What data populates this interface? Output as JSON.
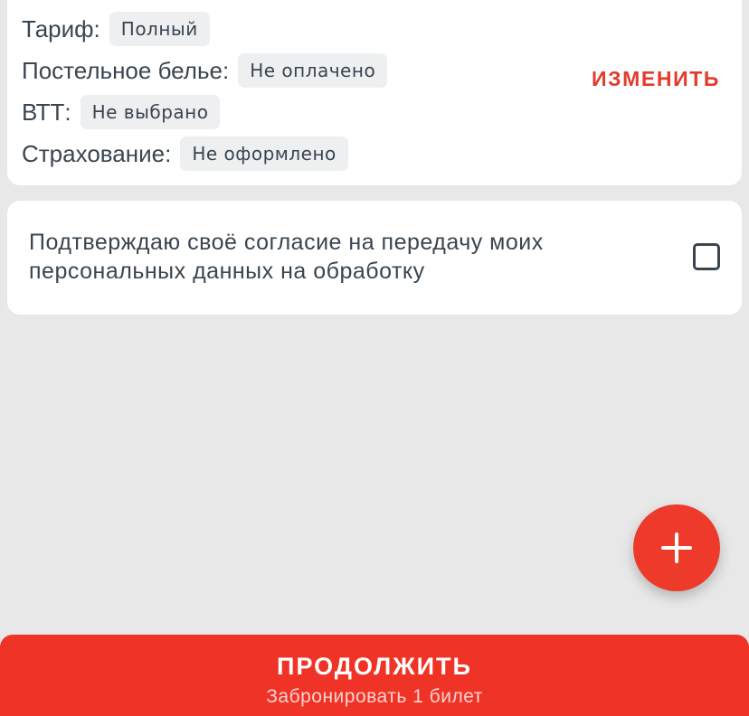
{
  "details": {
    "rows": [
      {
        "label": "Тариф:",
        "value": "Полный"
      },
      {
        "label": "Постельное белье:",
        "value": "Не оплачено"
      },
      {
        "label": "ВТТ:",
        "value": "Не выбрано"
      },
      {
        "label": "Страхование:",
        "value": "Не оформлено"
      }
    ],
    "change_label": "ИЗМЕНИТЬ"
  },
  "consent": {
    "text": "Подтверждаю своё согласие на передачу моих персональных данных на обработку",
    "checked": false
  },
  "fab": {
    "icon": "plus-icon"
  },
  "footer": {
    "continue_label": "ПРОДОЛЖИТЬ",
    "continue_sublabel": "Забронировать 1 билет"
  },
  "colors": {
    "accent": "#ef3326",
    "background": "#e8e8e8",
    "card": "#ffffff",
    "text": "#3a4550"
  }
}
